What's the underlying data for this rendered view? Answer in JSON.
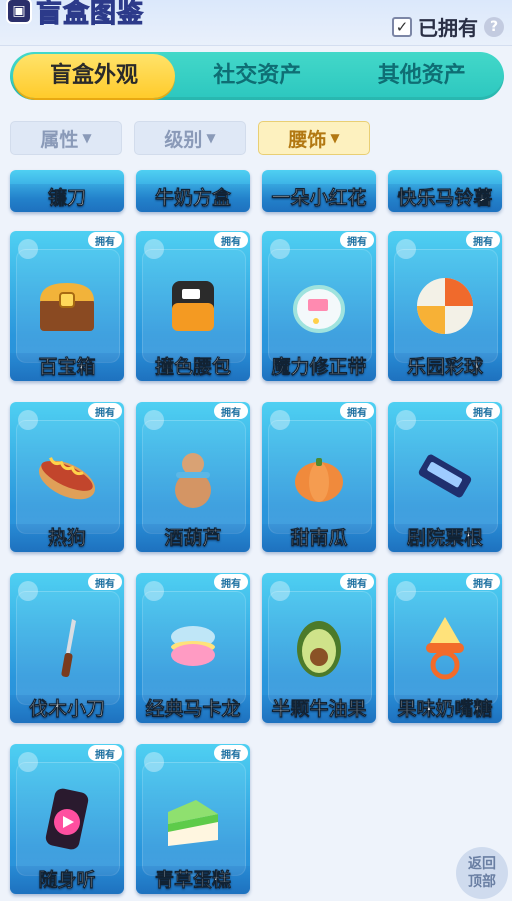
{
  "header": {
    "title": "盲盒图鉴",
    "owned_label": "已拥有",
    "owned_checked": true,
    "help": "?"
  },
  "tabs": [
    {
      "label": "盲盒外观",
      "active": true
    },
    {
      "label": "社交资产",
      "active": false
    },
    {
      "label": "其他资产",
      "active": false
    }
  ],
  "filters": [
    {
      "label": "属性",
      "active": false
    },
    {
      "label": "级别",
      "active": false
    },
    {
      "label": "腰饰",
      "active": true
    }
  ],
  "items_partial": [
    "镰刀",
    "牛奶方盒",
    "一朵小红花",
    "快乐马铃薯"
  ],
  "items": [
    {
      "label": "百宝箱",
      "badge": "拥有",
      "icon": "treasure-chest-icon"
    },
    {
      "label": "撞色腰包",
      "badge": "拥有",
      "icon": "waist-bag-icon"
    },
    {
      "label": "魔力修正带",
      "badge": "拥有",
      "icon": "correction-tape-icon"
    },
    {
      "label": "乐园彩球",
      "badge": "拥有",
      "icon": "beach-ball-icon"
    },
    {
      "label": "热狗",
      "badge": "拥有",
      "icon": "hotdog-icon"
    },
    {
      "label": "酒葫芦",
      "badge": "拥有",
      "icon": "gourd-icon"
    },
    {
      "label": "甜南瓜",
      "badge": "拥有",
      "icon": "pumpkin-icon"
    },
    {
      "label": "剧院票根",
      "badge": "拥有",
      "icon": "ticket-icon"
    },
    {
      "label": "伐木小刀",
      "badge": "拥有",
      "icon": "knife-icon"
    },
    {
      "label": "经典马卡龙",
      "badge": "拥有",
      "icon": "macaron-icon"
    },
    {
      "label": "半颗牛油果",
      "badge": "拥有",
      "icon": "avocado-icon"
    },
    {
      "label": "果味奶嘴糖",
      "badge": "拥有",
      "icon": "pacifier-candy-icon"
    },
    {
      "label": "随身听",
      "badge": "拥有",
      "icon": "music-player-icon"
    },
    {
      "label": "青草蛋糕",
      "badge": "拥有",
      "icon": "cake-icon"
    }
  ],
  "back_top": {
    "line1": "返回",
    "line2": "顶部"
  }
}
